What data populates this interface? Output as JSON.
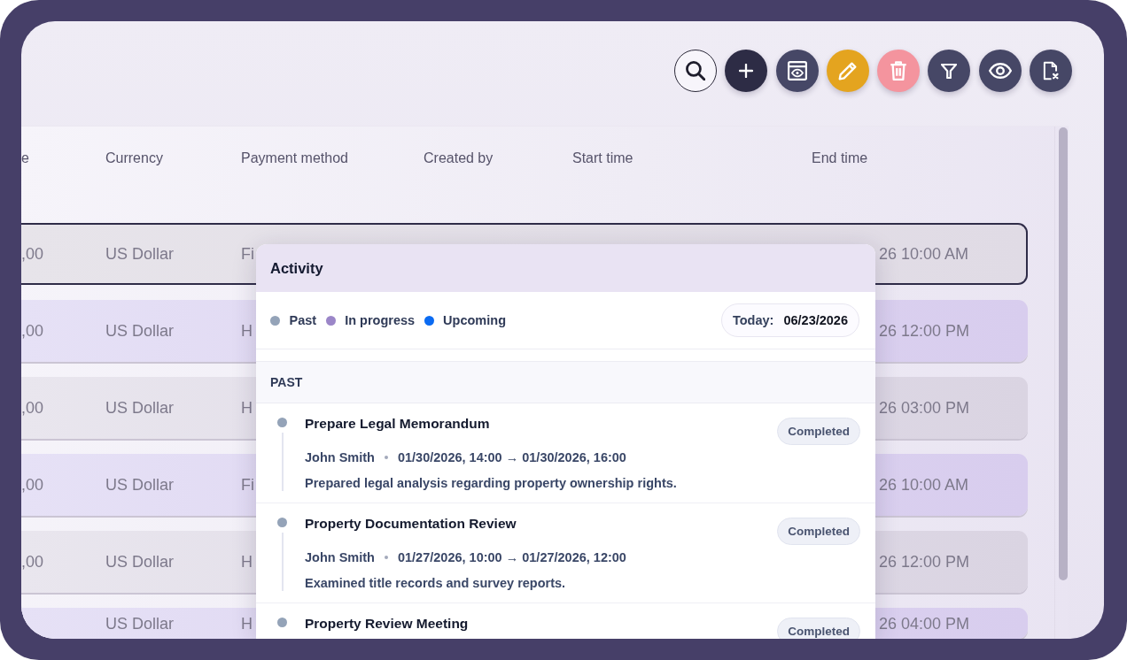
{
  "toolbar": {
    "buttons": [
      {
        "kind": "search"
      },
      {
        "kind": "add"
      },
      {
        "kind": "preview"
      },
      {
        "kind": "edit"
      },
      {
        "kind": "delete"
      },
      {
        "kind": "filter"
      },
      {
        "kind": "view"
      },
      {
        "kind": "clear"
      }
    ]
  },
  "table": {
    "columns": [
      "e",
      "Currency",
      "Payment method",
      "Created by",
      "Start time",
      "End time"
    ],
    "rows": [
      {
        "selected": true,
        "column_1": ",00",
        "currency": "US Dollar",
        "payment_method": "Fi",
        "end_time": "26 10:00 AM"
      },
      {
        "selected": false,
        "column_1": ",00",
        "currency": "US Dollar",
        "payment_method": "H",
        "end_time": "26 12:00 PM"
      },
      {
        "selected": false,
        "column_1": ",00",
        "currency": "US Dollar",
        "payment_method": "H",
        "end_time": "26 03:00 PM"
      },
      {
        "selected": false,
        "column_1": ",00",
        "currency": "US Dollar",
        "payment_method": "Fi",
        "end_time": "26 10:00 AM"
      },
      {
        "selected": false,
        "column_1": ",00",
        "currency": "US Dollar",
        "payment_method": "H",
        "end_time": "26 12:00 PM"
      },
      {
        "selected": false,
        "currency": "US Dollar",
        "payment_method": "H",
        "end_time": "26 04:00 PM"
      }
    ]
  },
  "activity": {
    "title": "Activity",
    "legend": [
      {
        "label": "Past",
        "color": "#94a3b8"
      },
      {
        "label": "In progress",
        "color": "#9b86c8"
      },
      {
        "label": "Upcoming",
        "color": "#0b6bf2"
      }
    ],
    "today": {
      "label": "Today:",
      "value": "06/23/2026"
    },
    "sections": [
      {
        "title": "PAST",
        "items": [
          {
            "title": "Prepare Legal Memorandum",
            "status": "Completed",
            "color": "#94a3b8",
            "author": "John Smith",
            "time": "01/30/2026, 14:00 → 01/30/2026, 16:00",
            "description": "Prepared legal analysis regarding property ownership rights."
          },
          {
            "title": "Property Documentation Review",
            "status": "Completed",
            "color": "#94a3b8",
            "author": "John Smith",
            "time": "01/27/2026, 10:00 → 01/27/2026, 12:00",
            "description": "Examined title records and survey reports."
          },
          {
            "title": "Property Review Meeting",
            "status": "Completed",
            "color": "#94a3b8"
          }
        ]
      }
    ]
  }
}
